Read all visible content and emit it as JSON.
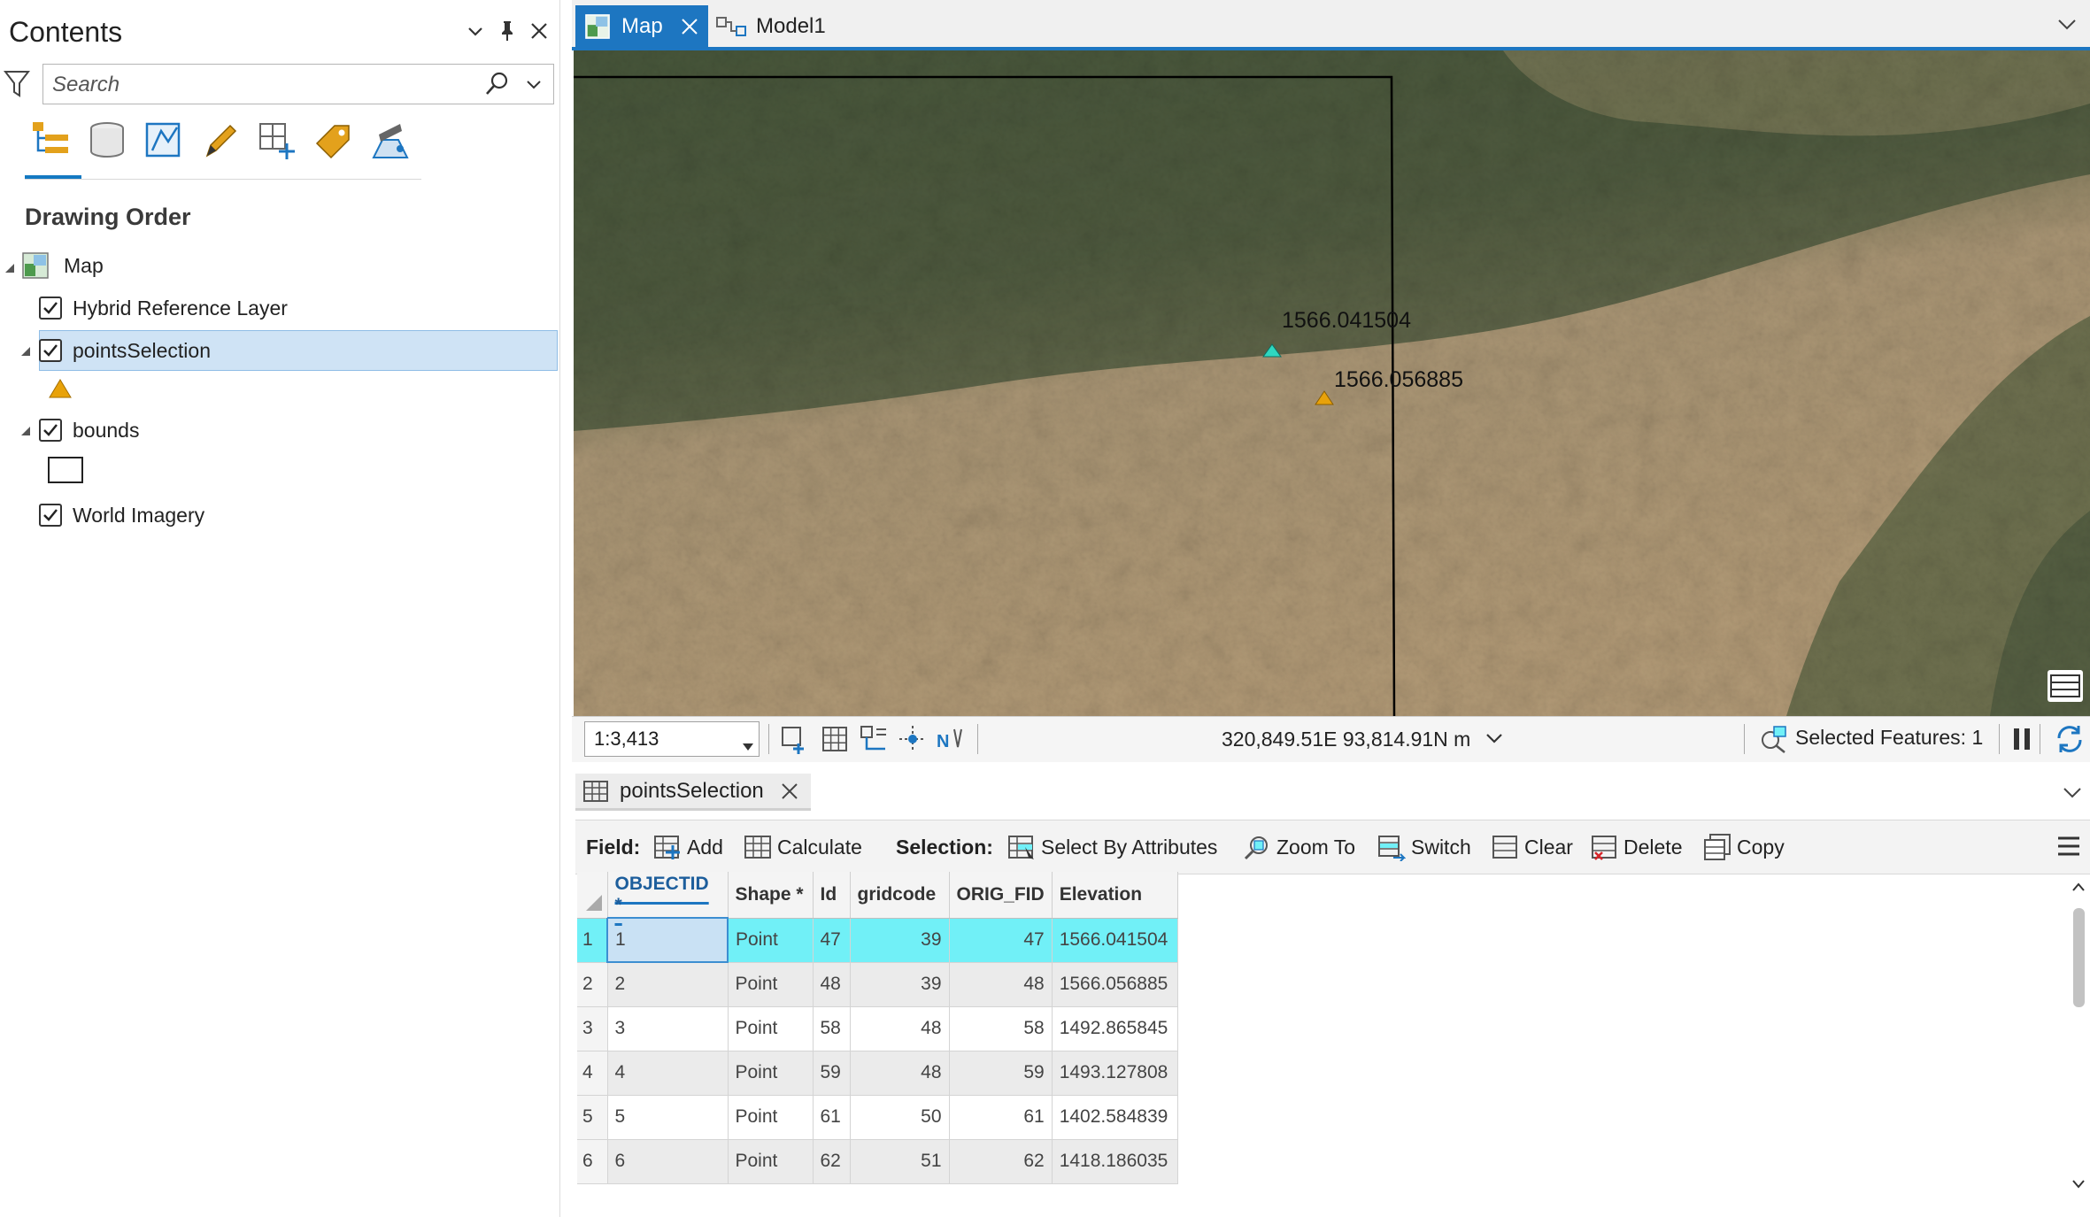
{
  "contents_pane": {
    "title": "Contents",
    "search_placeholder": "Search",
    "section_title": "Drawing Order",
    "layers": [
      {
        "label": "Map"
      },
      {
        "label": "Hybrid Reference Layer"
      },
      {
        "label": "pointsSelection"
      },
      {
        "label": "bounds"
      },
      {
        "label": "World Imagery"
      }
    ],
    "toolbar_icons": [
      "list-by-drawing-order-icon",
      "list-by-data-source-icon",
      "list-by-selection-icon",
      "list-by-editing-icon",
      "list-by-snapping-icon",
      "list-by-labeling-icon",
      "list-by-perspective-icon"
    ]
  },
  "doc_tabs": [
    {
      "label": "Map",
      "active": true
    },
    {
      "label": "Model1",
      "active": false
    }
  ],
  "map": {
    "labels": [
      {
        "text": "1566.041504"
      },
      {
        "text": "1566.056885"
      }
    ],
    "point_colors": {
      "selected": "#2ed7c0",
      "unselected": "#e8a20a"
    }
  },
  "map_status": {
    "scale": "1:3,413",
    "coordinates": "320,849.51E 93,814.91N m",
    "selected_features": "Selected Features: 1"
  },
  "table_view": {
    "tab_label": "pointsSelection",
    "toolbar": {
      "field_label": "Field:",
      "add": "Add",
      "calculate": "Calculate",
      "selection_label": "Selection:",
      "select_by_attributes": "Select By Attributes",
      "zoom_to": "Zoom To",
      "switch": "Switch",
      "clear": "Clear",
      "delete": "Delete",
      "copy": "Copy"
    },
    "columns": [
      "OBJECTID *",
      "Shape *",
      "Id",
      "gridcode",
      "ORIG_FID",
      "Elevation"
    ],
    "rows": [
      {
        "n": "1",
        "objectid": "1",
        "shape": "Point",
        "id": "47",
        "gridcode": "39",
        "orig_fid": "47",
        "elevation": "1566.041504"
      },
      {
        "n": "2",
        "objectid": "2",
        "shape": "Point",
        "id": "48",
        "gridcode": "39",
        "orig_fid": "48",
        "elevation": "1566.056885"
      },
      {
        "n": "3",
        "objectid": "3",
        "shape": "Point",
        "id": "58",
        "gridcode": "48",
        "orig_fid": "58",
        "elevation": "1492.865845"
      },
      {
        "n": "4",
        "objectid": "4",
        "shape": "Point",
        "id": "59",
        "gridcode": "48",
        "orig_fid": "59",
        "elevation": "1493.127808"
      },
      {
        "n": "5",
        "objectid": "5",
        "shape": "Point",
        "id": "61",
        "gridcode": "50",
        "orig_fid": "61",
        "elevation": "1402.584839"
      },
      {
        "n": "6",
        "objectid": "6",
        "shape": "Point",
        "id": "62",
        "gridcode": "51",
        "orig_fid": "62",
        "elevation": "1418.186035"
      }
    ]
  },
  "colors": {
    "accent": "#1d76c1",
    "selection_row": "#71f0f7"
  }
}
